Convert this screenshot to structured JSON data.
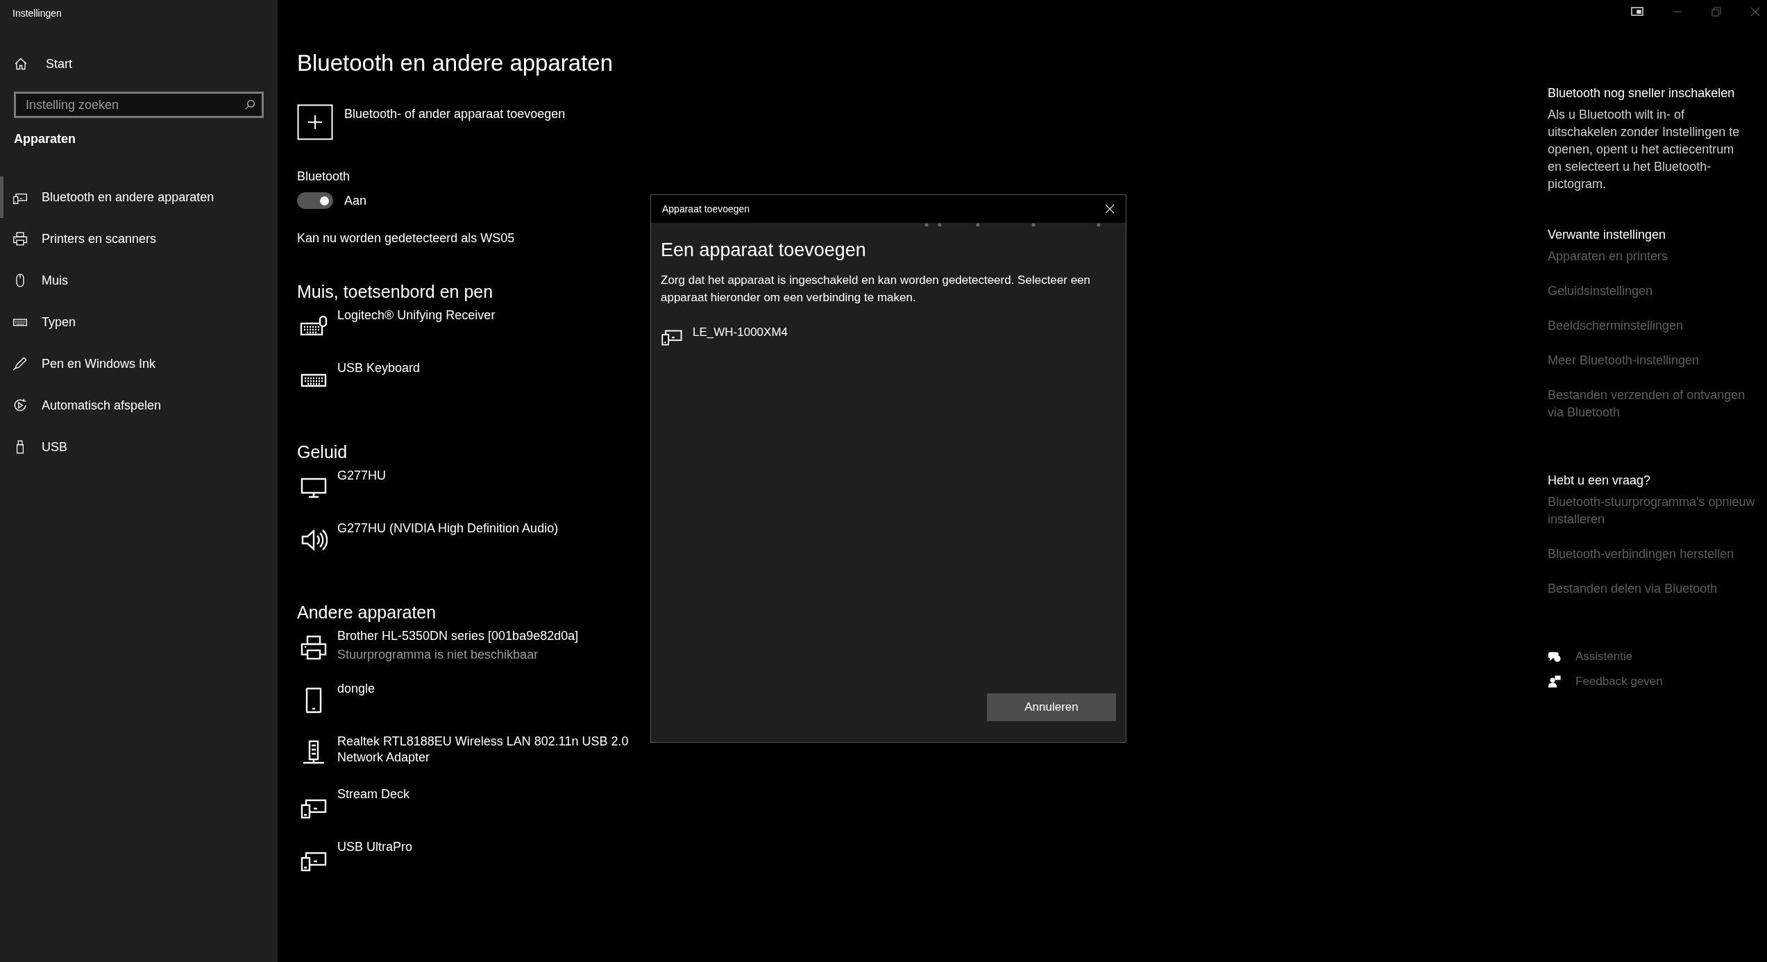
{
  "window": {
    "title": "Instellingen"
  },
  "sidebar": {
    "home": "Start",
    "search": {
      "placeholder": "Instelling zoeken"
    },
    "section": "Apparaten",
    "items": [
      {
        "label": "Bluetooth en andere apparaten",
        "kind": "devices",
        "selected": true
      },
      {
        "label": "Printers en scanners",
        "kind": "printer",
        "selected": false
      },
      {
        "label": "Muis",
        "kind": "mouse",
        "selected": false
      },
      {
        "label": "Typen",
        "kind": "keyboard",
        "selected": false
      },
      {
        "label": "Pen en Windows Ink",
        "kind": "pen",
        "selected": false
      },
      {
        "label": "Automatisch afspelen",
        "kind": "autoplay",
        "selected": false
      },
      {
        "label": "USB",
        "kind": "usb",
        "selected": false
      }
    ]
  },
  "main": {
    "title": "Bluetooth en andere apparaten",
    "add_device": "Bluetooth- of ander apparaat toevoegen",
    "bluetooth": {
      "label": "Bluetooth",
      "on": true,
      "state": "Aan"
    },
    "discoverable": "Kan nu worden gedetecteerd als WS05",
    "groups": [
      {
        "title": "Muis, toetsenbord en pen",
        "devices": [
          {
            "name": "Logitech® Unifying Receiver",
            "kind": "keyboard-mouse"
          },
          {
            "name": "USB Keyboard",
            "kind": "keyboard"
          }
        ]
      },
      {
        "title": "Geluid",
        "devices": [
          {
            "name": "G277HU",
            "kind": "monitor"
          },
          {
            "name": "G277HU (NVIDIA High Definition Audio)",
            "kind": "speaker"
          }
        ]
      },
      {
        "title": "Andere apparaten",
        "devices": [
          {
            "name": "Brother HL-5350DN series [001ba9e82d0a]",
            "status": "Stuurprogramma is niet beschikbaar",
            "kind": "printer"
          },
          {
            "name": "dongle",
            "kind": "phone"
          },
          {
            "name": "Realtek RTL8188EU Wireless LAN 802.11n USB 2.0 Network Adapter",
            "kind": "network"
          },
          {
            "name": "Stream Deck",
            "kind": "devices"
          },
          {
            "name": "USB UltraPro",
            "kind": "devices"
          }
        ]
      }
    ]
  },
  "dialog": {
    "title": "Apparaat toevoegen",
    "heading": "Een apparaat toevoegen",
    "text": "Zorg dat het apparaat is ingeschakeld en kan worden gedetecteerd. Selecteer een apparaat hieronder om een verbinding te maken.",
    "devices": [
      {
        "name": "LE_WH-1000XM4",
        "kind": "devices"
      }
    ],
    "cancel": "Annuleren"
  },
  "right_panel": {
    "sections": [
      {
        "title": "Bluetooth nog sneller inschakelen",
        "text": "Als u Bluetooth wilt in- of uitschakelen zonder Instellingen te openen, opent u het actiecentrum en selecteert u het Bluetooth-pictogram."
      },
      {
        "title": "Verwante instellingen",
        "links": [
          "Apparaten en printers",
          "Geluidsinstellingen",
          "Beeldscherminstellingen",
          "Meer Bluetooth-instellingen",
          "Bestanden verzenden of ontvangen via Bluetooth"
        ]
      },
      {
        "title": "Hebt u een vraag?",
        "links": [
          "Bluetooth-stuurprogramma's opnieuw installeren",
          "Bluetooth-verbindingen herstellen",
          "Bestanden delen via Bluetooth"
        ]
      }
    ],
    "help": [
      {
        "label": "Assistentie",
        "kind": "chat"
      },
      {
        "label": "Feedback geven",
        "kind": "feedback"
      }
    ]
  }
}
